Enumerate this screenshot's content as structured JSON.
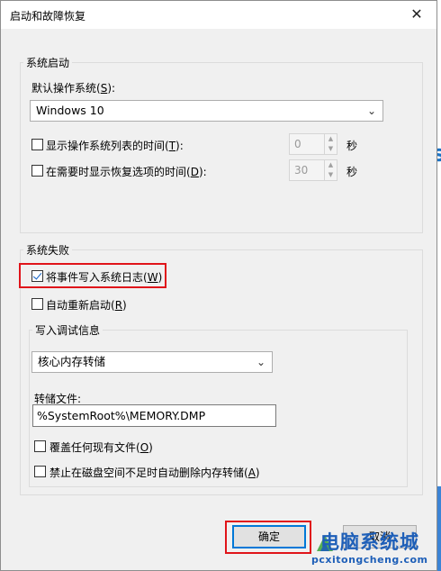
{
  "window": {
    "title": "启动和故障恢复"
  },
  "system_startup": {
    "group_label": "系统启动",
    "default_os_label": "默认操作系统(S):",
    "default_os_label_pre": "默认操作系统(",
    "default_os_label_key": "S",
    "default_os_label_post": "):",
    "default_os_value": "Windows 10",
    "show_os_list": {
      "checked": false,
      "label_pre": "显示操作系统列表的时间(",
      "key": "T",
      "label_post": "):",
      "value": "0",
      "unit": "秒"
    },
    "show_recovery": {
      "checked": false,
      "label_pre": "在需要时显示恢复选项的时间(",
      "key": "D",
      "label_post": "):",
      "value": "30",
      "unit": "秒"
    }
  },
  "system_failure": {
    "group_label": "系统失败",
    "write_event_log": {
      "checked": true,
      "label_pre": "将事件写入系统日志(",
      "key": "W",
      "label_post": ")"
    },
    "auto_restart": {
      "checked": false,
      "label_pre": "自动重新启动(",
      "key": "R",
      "label_post": ")"
    },
    "debug_info": {
      "group_label": "写入调试信息",
      "dump_type_value": "核心内存转储",
      "dump_file_label": "转储文件:",
      "dump_file_value": "%SystemRoot%\\MEMORY.DMP",
      "overwrite": {
        "checked": false,
        "label_pre": "覆盖任何现有文件(",
        "key": "O",
        "label_post": ")"
      },
      "disable_auto_delete": {
        "checked": false,
        "label_pre": "禁止在磁盘空间不足时自动删除内存转储(",
        "key": "A",
        "label_post": ")"
      }
    }
  },
  "buttons": {
    "ok": "确定",
    "cancel": "取消"
  },
  "watermark": {
    "text": "电脑系统城",
    "url": "pcxitongcheng.com"
  },
  "colors": {
    "highlight": "#e0141a",
    "focus": "#0078d7",
    "watermark": "#1e5fb8"
  }
}
